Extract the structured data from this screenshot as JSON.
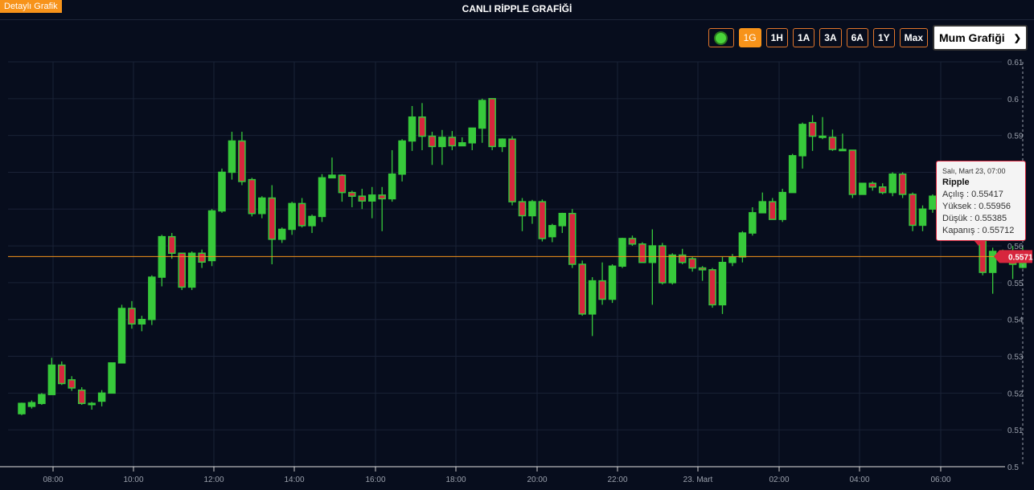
{
  "header": {
    "detail_button": "Detaylı Grafik",
    "title": "CANLI RİPPLE GRAFİĞİ"
  },
  "toolbar": {
    "ranges": [
      "1G",
      "1H",
      "1A",
      "3A",
      "6A",
      "1Y",
      "Max"
    ],
    "active_range": "1G",
    "chart_type": "Mum Grafiği"
  },
  "colors": {
    "up": "#37c93b",
    "down": "#d7263d",
    "accent": "#f7931a",
    "background": "#070d1d",
    "grid": "#1a2236"
  },
  "tooltip": {
    "date": "Salı, Mart 23, 07:00",
    "name": "Ripple",
    "open_label": "Açılış",
    "open": "0.55417",
    "high_label": "Yüksek",
    "high": "0.55956",
    "low_label": "Düşük",
    "low": "0.55385",
    "close_label": "Kapanış",
    "close": "0.55712"
  },
  "chart_data": {
    "type": "candlestick",
    "series_name": "Ripple",
    "x_ticks": [
      "08:00",
      "10:00",
      "12:00",
      "14:00",
      "16:00",
      "18:00",
      "20:00",
      "22:00",
      "23. Mart",
      "02:00",
      "04:00",
      "06:00"
    ],
    "y_ticks": [
      "0.5",
      "0.51",
      "0.52",
      "0.53",
      "0.54",
      "0.55",
      "0.56",
      "0.57",
      "0.58",
      "0.59",
      "0.6",
      "0.61"
    ],
    "ylim": [
      0.5,
      0.61
    ],
    "last_price": "0.5571",
    "grid": true,
    "candles": [
      {
        "o": 0.5144,
        "h": 0.5174,
        "l": 0.514,
        "c": 0.5172
      },
      {
        "o": 0.5164,
        "h": 0.518,
        "l": 0.5158,
        "c": 0.5174
      },
      {
        "o": 0.5172,
        "h": 0.52,
        "l": 0.5168,
        "c": 0.5196
      },
      {
        "o": 0.5196,
        "h": 0.5296,
        "l": 0.5196,
        "c": 0.5276
      },
      {
        "o": 0.5276,
        "h": 0.5286,
        "l": 0.5222,
        "c": 0.5226
      },
      {
        "o": 0.5236,
        "h": 0.5246,
        "l": 0.5206,
        "c": 0.5214
      },
      {
        "o": 0.5208,
        "h": 0.5216,
        "l": 0.5168,
        "c": 0.5172
      },
      {
        "o": 0.5172,
        "h": 0.5176,
        "l": 0.5155,
        "c": 0.5172
      },
      {
        "o": 0.5178,
        "h": 0.5208,
        "l": 0.5164,
        "c": 0.52
      },
      {
        "o": 0.52,
        "h": 0.5282,
        "l": 0.52,
        "c": 0.5282
      },
      {
        "o": 0.5282,
        "h": 0.544,
        "l": 0.5282,
        "c": 0.543
      },
      {
        "o": 0.543,
        "h": 0.545,
        "l": 0.5375,
        "c": 0.5388
      },
      {
        "o": 0.5388,
        "h": 0.541,
        "l": 0.5368,
        "c": 0.54
      },
      {
        "o": 0.54,
        "h": 0.552,
        "l": 0.5385,
        "c": 0.5515
      },
      {
        "o": 0.5515,
        "h": 0.563,
        "l": 0.549,
        "c": 0.5625
      },
      {
        "o": 0.5625,
        "h": 0.5635,
        "l": 0.5565,
        "c": 0.558
      },
      {
        "o": 0.558,
        "h": 0.558,
        "l": 0.548,
        "c": 0.5488
      },
      {
        "o": 0.5488,
        "h": 0.5585,
        "l": 0.548,
        "c": 0.558
      },
      {
        "o": 0.558,
        "h": 0.559,
        "l": 0.554,
        "c": 0.5556
      },
      {
        "o": 0.556,
        "h": 0.57,
        "l": 0.5545,
        "c": 0.5695
      },
      {
        "o": 0.5695,
        "h": 0.581,
        "l": 0.569,
        "c": 0.58
      },
      {
        "o": 0.58,
        "h": 0.591,
        "l": 0.578,
        "c": 0.5885
      },
      {
        "o": 0.5885,
        "h": 0.591,
        "l": 0.5765,
        "c": 0.5775
      },
      {
        "o": 0.578,
        "h": 0.5785,
        "l": 0.568,
        "c": 0.5688
      },
      {
        "o": 0.5688,
        "h": 0.5735,
        "l": 0.5675,
        "c": 0.573
      },
      {
        "o": 0.573,
        "h": 0.5765,
        "l": 0.555,
        "c": 0.5618
      },
      {
        "o": 0.5618,
        "h": 0.565,
        "l": 0.5608,
        "c": 0.5645
      },
      {
        "o": 0.5645,
        "h": 0.572,
        "l": 0.563,
        "c": 0.5715
      },
      {
        "o": 0.5715,
        "h": 0.573,
        "l": 0.565,
        "c": 0.5655
      },
      {
        "o": 0.5655,
        "h": 0.5685,
        "l": 0.5635,
        "c": 0.568
      },
      {
        "o": 0.568,
        "h": 0.5795,
        "l": 0.5665,
        "c": 0.5785
      },
      {
        "o": 0.5785,
        "h": 0.584,
        "l": 0.579,
        "c": 0.5792
      },
      {
        "o": 0.5792,
        "h": 0.5795,
        "l": 0.572,
        "c": 0.5745
      },
      {
        "o": 0.5745,
        "h": 0.575,
        "l": 0.5705,
        "c": 0.5735
      },
      {
        "o": 0.5735,
        "h": 0.5755,
        "l": 0.57,
        "c": 0.5722
      },
      {
        "o": 0.5722,
        "h": 0.576,
        "l": 0.5675,
        "c": 0.5738
      },
      {
        "o": 0.5738,
        "h": 0.576,
        "l": 0.564,
        "c": 0.5728
      },
      {
        "o": 0.5728,
        "h": 0.586,
        "l": 0.572,
        "c": 0.5795
      },
      {
        "o": 0.5795,
        "h": 0.589,
        "l": 0.5775,
        "c": 0.5885
      },
      {
        "o": 0.5885,
        "h": 0.598,
        "l": 0.5858,
        "c": 0.595
      },
      {
        "o": 0.595,
        "h": 0.5988,
        "l": 0.586,
        "c": 0.5898
      },
      {
        "o": 0.5898,
        "h": 0.591,
        "l": 0.582,
        "c": 0.587
      },
      {
        "o": 0.587,
        "h": 0.5915,
        "l": 0.582,
        "c": 0.5895
      },
      {
        "o": 0.5895,
        "h": 0.5912,
        "l": 0.586,
        "c": 0.5872
      },
      {
        "o": 0.5872,
        "h": 0.5895,
        "l": 0.5875,
        "c": 0.588
      },
      {
        "o": 0.588,
        "h": 0.592,
        "l": 0.586,
        "c": 0.592
      },
      {
        "o": 0.592,
        "h": 0.6,
        "l": 0.588,
        "c": 0.5995
      },
      {
        "o": 0.6,
        "h": 0.6,
        "l": 0.586,
        "c": 0.587
      },
      {
        "o": 0.587,
        "h": 0.5892,
        "l": 0.5855,
        "c": 0.589
      },
      {
        "o": 0.589,
        "h": 0.5898,
        "l": 0.571,
        "c": 0.572
      },
      {
        "o": 0.572,
        "h": 0.573,
        "l": 0.564,
        "c": 0.5682
      },
      {
        "o": 0.5682,
        "h": 0.5725,
        "l": 0.566,
        "c": 0.572
      },
      {
        "o": 0.572,
        "h": 0.5726,
        "l": 0.5612,
        "c": 0.562
      },
      {
        "o": 0.5625,
        "h": 0.566,
        "l": 0.561,
        "c": 0.5655
      },
      {
        "o": 0.5655,
        "h": 0.569,
        "l": 0.5635,
        "c": 0.5688
      },
      {
        "o": 0.5688,
        "h": 0.57,
        "l": 0.554,
        "c": 0.555
      },
      {
        "o": 0.555,
        "h": 0.556,
        "l": 0.541,
        "c": 0.5415
      },
      {
        "o": 0.5415,
        "h": 0.5515,
        "l": 0.5355,
        "c": 0.5505
      },
      {
        "o": 0.5505,
        "h": 0.5555,
        "l": 0.544,
        "c": 0.5455
      },
      {
        "o": 0.5455,
        "h": 0.555,
        "l": 0.5445,
        "c": 0.5545
      },
      {
        "o": 0.5545,
        "h": 0.5622,
        "l": 0.554,
        "c": 0.562
      },
      {
        "o": 0.562,
        "h": 0.5628,
        "l": 0.56,
        "c": 0.5605
      },
      {
        "o": 0.5605,
        "h": 0.561,
        "l": 0.5555,
        "c": 0.5555
      },
      {
        "o": 0.5555,
        "h": 0.5645,
        "l": 0.544,
        "c": 0.56
      },
      {
        "o": 0.56,
        "h": 0.5608,
        "l": 0.5495,
        "c": 0.55
      },
      {
        "o": 0.55,
        "h": 0.558,
        "l": 0.5495,
        "c": 0.5575
      },
      {
        "o": 0.5575,
        "h": 0.5592,
        "l": 0.555,
        "c": 0.5555
      },
      {
        "o": 0.5565,
        "h": 0.557,
        "l": 0.553,
        "c": 0.554
      },
      {
        "o": 0.554,
        "h": 0.5545,
        "l": 0.5505,
        "c": 0.5535
      },
      {
        "o": 0.5535,
        "h": 0.554,
        "l": 0.5432,
        "c": 0.544
      },
      {
        "o": 0.544,
        "h": 0.557,
        "l": 0.5415,
        "c": 0.5555
      },
      {
        "o": 0.5555,
        "h": 0.5578,
        "l": 0.5545,
        "c": 0.557
      },
      {
        "o": 0.557,
        "h": 0.564,
        "l": 0.5555,
        "c": 0.5635
      },
      {
        "o": 0.5635,
        "h": 0.5705,
        "l": 0.5628,
        "c": 0.569
      },
      {
        "o": 0.569,
        "h": 0.5745,
        "l": 0.569,
        "c": 0.572
      },
      {
        "o": 0.572,
        "h": 0.573,
        "l": 0.568,
        "c": 0.5672
      },
      {
        "o": 0.5672,
        "h": 0.5755,
        "l": 0.5665,
        "c": 0.5745
      },
      {
        "o": 0.5745,
        "h": 0.585,
        "l": 0.5745,
        "c": 0.5845
      },
      {
        "o": 0.5845,
        "h": 0.5935,
        "l": 0.581,
        "c": 0.593
      },
      {
        "o": 0.5935,
        "h": 0.5955,
        "l": 0.5858,
        "c": 0.5898
      },
      {
        "o": 0.5898,
        "h": 0.595,
        "l": 0.589,
        "c": 0.5895
      },
      {
        "o": 0.5895,
        "h": 0.5916,
        "l": 0.5858,
        "c": 0.5862
      },
      {
        "o": 0.5862,
        "h": 0.5905,
        "l": 0.586,
        "c": 0.586
      },
      {
        "o": 0.586,
        "h": 0.586,
        "l": 0.573,
        "c": 0.574
      },
      {
        "o": 0.574,
        "h": 0.577,
        "l": 0.574,
        "c": 0.577
      },
      {
        "o": 0.577,
        "h": 0.5775,
        "l": 0.575,
        "c": 0.576
      },
      {
        "o": 0.576,
        "h": 0.577,
        "l": 0.574,
        "c": 0.5745
      },
      {
        "o": 0.5745,
        "h": 0.58,
        "l": 0.5735,
        "c": 0.5795
      },
      {
        "o": 0.5795,
        "h": 0.58,
        "l": 0.573,
        "c": 0.574
      },
      {
        "o": 0.574,
        "h": 0.5745,
        "l": 0.564,
        "c": 0.5656
      },
      {
        "o": 0.5656,
        "h": 0.571,
        "l": 0.564,
        "c": 0.57
      },
      {
        "o": 0.57,
        "h": 0.574,
        "l": 0.569,
        "c": 0.5735
      },
      {
        "o": 0.5735,
        "h": 0.5745,
        "l": 0.5685,
        "c": 0.57
      },
      {
        "o": 0.57,
        "h": 0.5712,
        "l": 0.565,
        "c": 0.5688
      },
      {
        "o": 0.5688,
        "h": 0.57,
        "l": 0.5615,
        "c": 0.569
      },
      {
        "o": 0.569,
        "h": 0.5705,
        "l": 0.562,
        "c": 0.563
      },
      {
        "o": 0.563,
        "h": 0.5645,
        "l": 0.552,
        "c": 0.5528
      },
      {
        "o": 0.5528,
        "h": 0.5595,
        "l": 0.547,
        "c": 0.5585
      },
      {
        "o": 0.5585,
        "h": 0.559,
        "l": 0.557,
        "c": 0.5575
      },
      {
        "o": 0.557,
        "h": 0.56,
        "l": 0.551,
        "c": 0.555
      },
      {
        "o": 0.55417,
        "h": 0.55956,
        "l": 0.55385,
        "c": 0.55712
      }
    ]
  }
}
